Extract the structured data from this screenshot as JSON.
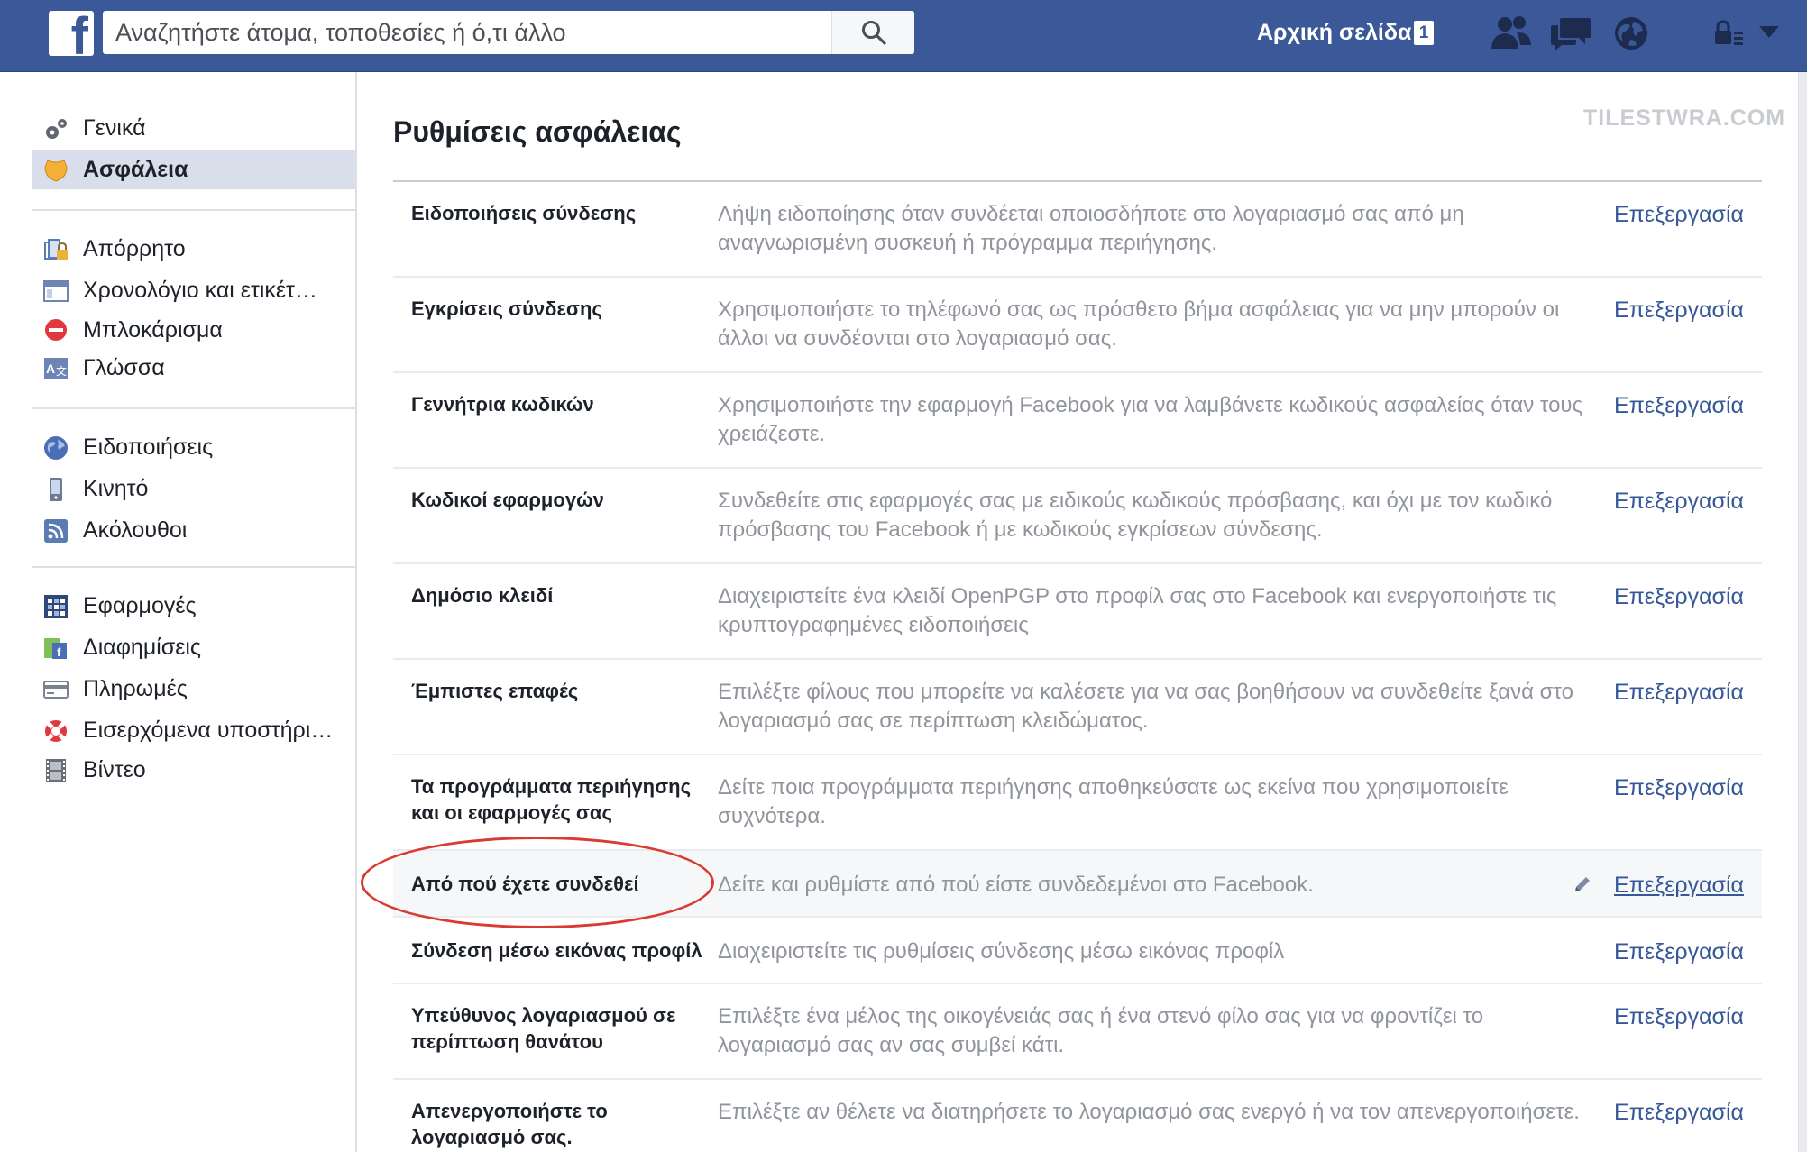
{
  "topbar": {
    "logo_letter": "f",
    "search_placeholder": "Αναζητήστε άτομα, τοποθεσίες ή ό,τι άλλο",
    "home_label": "Αρχική σελίδα",
    "home_count": "1",
    "icons": [
      "friends-icon",
      "messages-icon",
      "notifications-globe-icon",
      "privacy-lock-icon",
      "account-menu-chevron-icon"
    ],
    "bar_color": "#3b5998"
  },
  "sidebar": {
    "items": [
      {
        "label": "Γενικά",
        "icon": "gears-icon",
        "active": false
      },
      {
        "label": "Ασφάλεια",
        "icon": "security-badge-icon",
        "active": true
      },
      {
        "label": "Απόρρητο",
        "icon": "privacy-lock-icon",
        "active": false
      },
      {
        "label": "Χρονολόγιο και ετικέτ…",
        "icon": "timeline-icon",
        "active": false
      },
      {
        "label": "Μπλοκάρισμα",
        "icon": "block-icon",
        "active": false
      },
      {
        "label": "Γλώσσα",
        "icon": "language-icon",
        "active": false
      },
      {
        "label": "Ειδοποιήσεις",
        "icon": "globe-icon",
        "active": false
      },
      {
        "label": "Κινητό",
        "icon": "mobile-icon",
        "active": false
      },
      {
        "label": "Ακόλουθοι",
        "icon": "rss-icon",
        "active": false
      },
      {
        "label": "Εφαρμογές",
        "icon": "apps-grid-icon",
        "active": false
      },
      {
        "label": "Διαφημίσεις",
        "icon": "ads-icon",
        "active": false
      },
      {
        "label": "Πληρωμές",
        "icon": "credit-card-icon",
        "active": false
      },
      {
        "label": "Εισερχόμενα υποστήρι…",
        "icon": "lifebuoy-icon",
        "active": false
      },
      {
        "label": "Βίντεο",
        "icon": "film-icon",
        "active": false
      }
    ]
  },
  "main": {
    "title": "Ρυθμίσεις ασφάλειας",
    "watermark": "TILESTWRA.COM",
    "rows": [
      {
        "name": "Ειδοποιήσεις σύνδεσης",
        "desc": "Λήψη ειδοποίησης όταν συνδέεται οποιοσδήποτε στο λογαριασμό σας από μη αναγνωρισμένη συσκευή ή πρόγραμμα περιήγησης.",
        "edit": "Επεξεργασία"
      },
      {
        "name": "Εγκρίσεις σύνδεσης",
        "desc": "Χρησιμοποιήστε το τηλέφωνό σας ως πρόσθετο βήμα ασφάλειας για να μην μπορούν οι άλλοι να συνδέονται στο λογαριασμό σας.",
        "edit": "Επεξεργασία"
      },
      {
        "name": "Γεννήτρια κωδικών",
        "desc": "Χρησιμοποιήστε την εφαρμογή Facebook για να λαμβάνετε κωδικούς ασφαλείας όταν τους χρειάζεστε.",
        "edit": "Επεξεργασία"
      },
      {
        "name": "Κωδικοί εφαρμογών",
        "desc": "Συνδεθείτε στις εφαρμογές σας με ειδικούς κωδικούς πρόσβασης, και όχι με τον κωδικό πρόσβασης του Facebook ή με κωδικούς εγκρίσεων σύνδεσης.",
        "edit": "Επεξεργασία"
      },
      {
        "name": "Δημόσιο κλειδί",
        "desc": "Διαχειριστείτε ένα κλειδί OpenPGP στο προφίλ σας στο Facebook και ενεργοποιήστε τις κρυπτογραφημένες ειδοποιήσεις",
        "edit": "Επεξεργασία"
      },
      {
        "name": "Έμπιστες επαφές",
        "desc": "Επιλέξτε φίλους που μπορείτε να καλέσετε για να σας βοηθήσουν να συνδεθείτε ξανά στο λογαριασμό σας σε περίπτωση κλειδώματος.",
        "edit": "Επεξεργασία"
      },
      {
        "name": "Τα προγράμματα περιήγησης και οι εφαρμογές σας",
        "desc": "Δείτε ποια προγράμματα περιήγησης αποθηκεύσατε ως εκείνα που χρησιμοποιείτε συχνότερα.",
        "edit": "Επεξεργασία"
      },
      {
        "name": "Από πού έχετε συνδεθεί",
        "desc": "Δείτε και ρυθμίστε από πού είστε συνδεδεμένοι στο Facebook.",
        "edit": "Επεξεργασία"
      },
      {
        "name": "Σύνδεση μέσω εικόνας προφίλ",
        "desc": "Διαχειριστείτε τις ρυθμίσεις σύνδεσης μέσω εικόνας προφίλ",
        "edit": "Επεξεργασία"
      },
      {
        "name": "Υπεύθυνος λογαριασμού σε περίπτωση θανάτου",
        "desc": "Επιλέξτε ένα μέλος της οικογένειάς σας ή ένα στενό φίλο σας για να φροντίζει το λογαριασμό σας αν σας συμβεί κάτι.",
        "edit": "Επεξεργασία"
      },
      {
        "name": "Απενεργοποιήστε το λογαριασμό σας.",
        "desc": "Επιλέξτε αν θέλετε να διατηρήσετε το λογαριασμό σας ενεργό ή να τον απενεργοποιήσετε.",
        "edit": "Επεξεργασία"
      }
    ],
    "highlighted_row": "Από πού έχετε συνδεθεί",
    "annotation_color": "#d93b30",
    "link_color": "#365899"
  }
}
